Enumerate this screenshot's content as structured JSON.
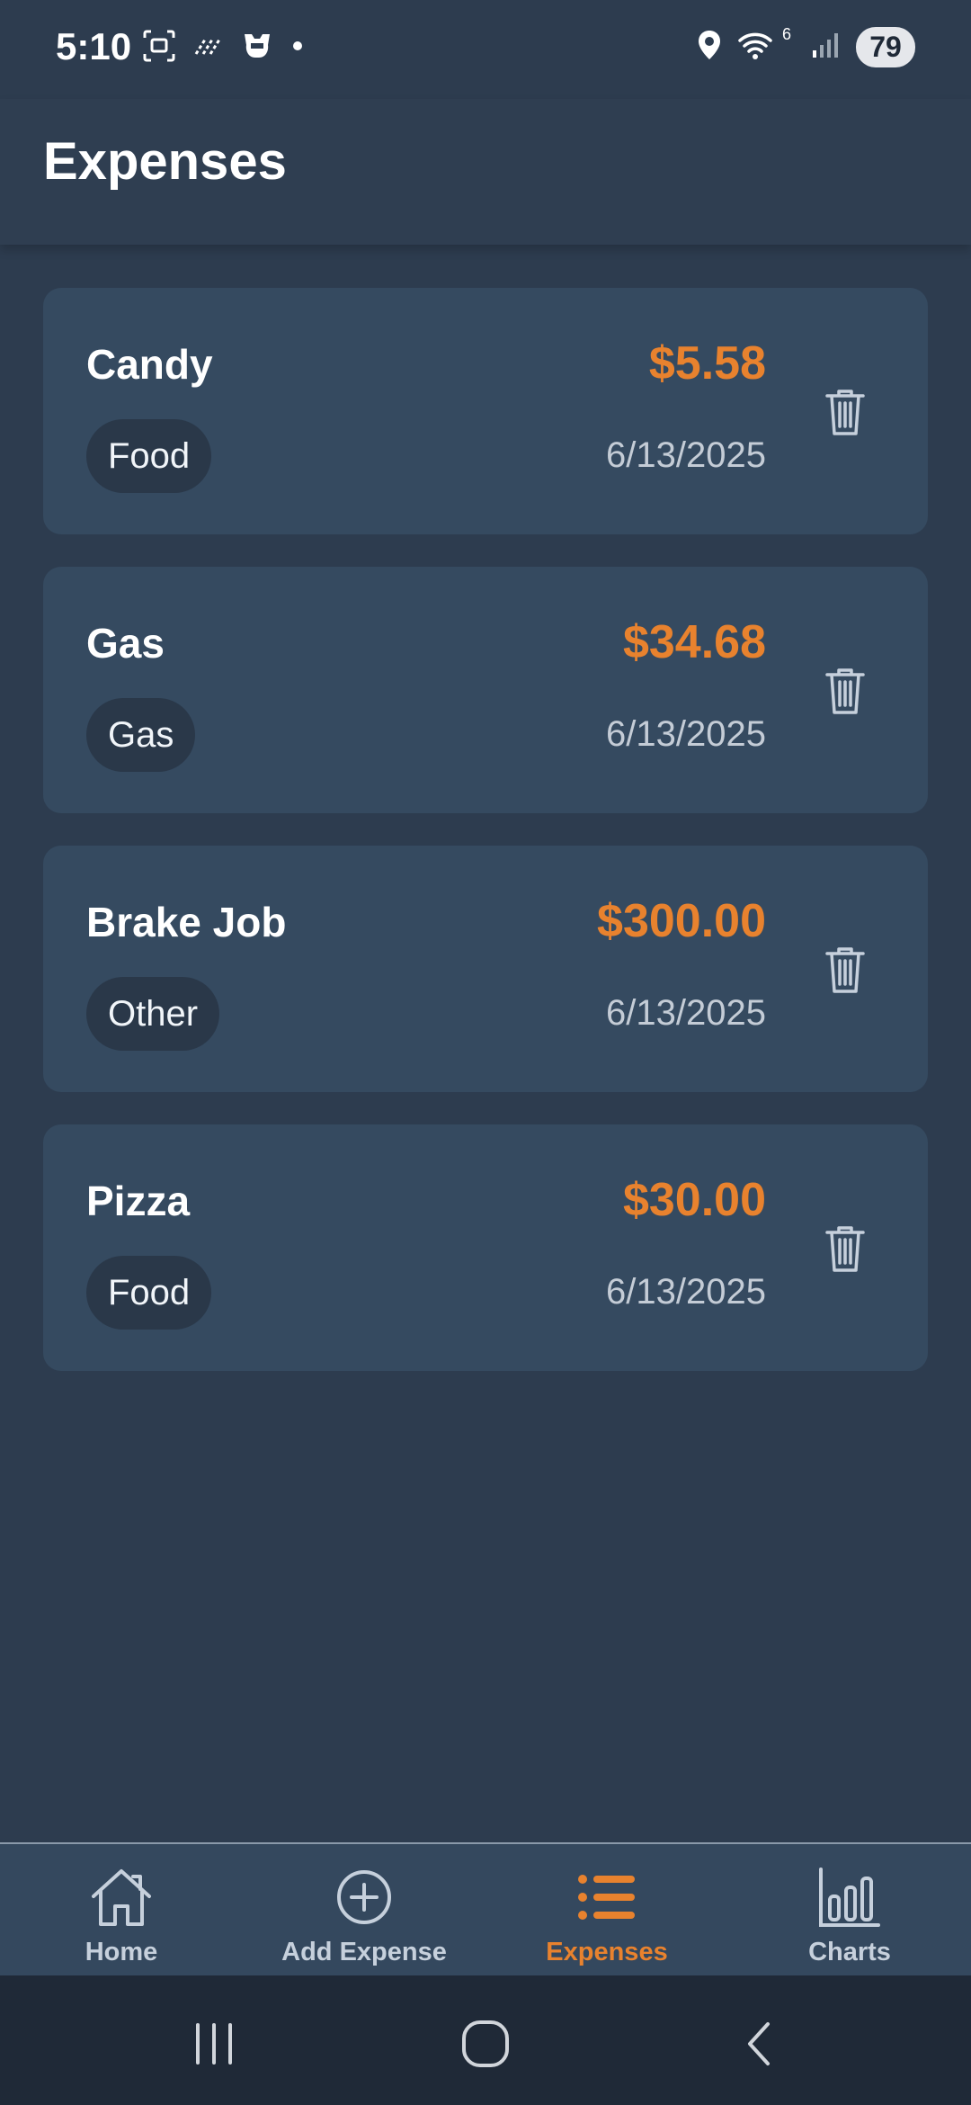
{
  "status_bar": {
    "time": "5:10",
    "battery": "79",
    "wifi_label": "6",
    "icons": [
      "screenshot-icon",
      "nfc-icon",
      "game-icon",
      "dot-icon",
      "location-icon",
      "wifi-icon",
      "signal-icon"
    ]
  },
  "header": {
    "title": "Expenses"
  },
  "expenses": [
    {
      "name": "Candy",
      "category": "Food",
      "amount": "$5.58",
      "date": "6/13/2025"
    },
    {
      "name": "Gas",
      "category": "Gas",
      "amount": "$34.68",
      "date": "6/13/2025"
    },
    {
      "name": "Brake Job",
      "category": "Other",
      "amount": "$300.00",
      "date": "6/13/2025"
    },
    {
      "name": "Pizza",
      "category": "Food",
      "amount": "$30.00",
      "date": "6/13/2025"
    }
  ],
  "bottom_nav": {
    "items": [
      {
        "label": "Home",
        "icon": "home-icon"
      },
      {
        "label": "Add Expense",
        "icon": "add-circle-icon"
      },
      {
        "label": "Expenses",
        "icon": "list-icon",
        "active": true
      },
      {
        "label": "Charts",
        "icon": "bar-chart-icon"
      }
    ]
  },
  "colors": {
    "background": "#2d3c4f",
    "card": "#354a60",
    "accent": "#e8822e",
    "chip": "#2a3849"
  }
}
